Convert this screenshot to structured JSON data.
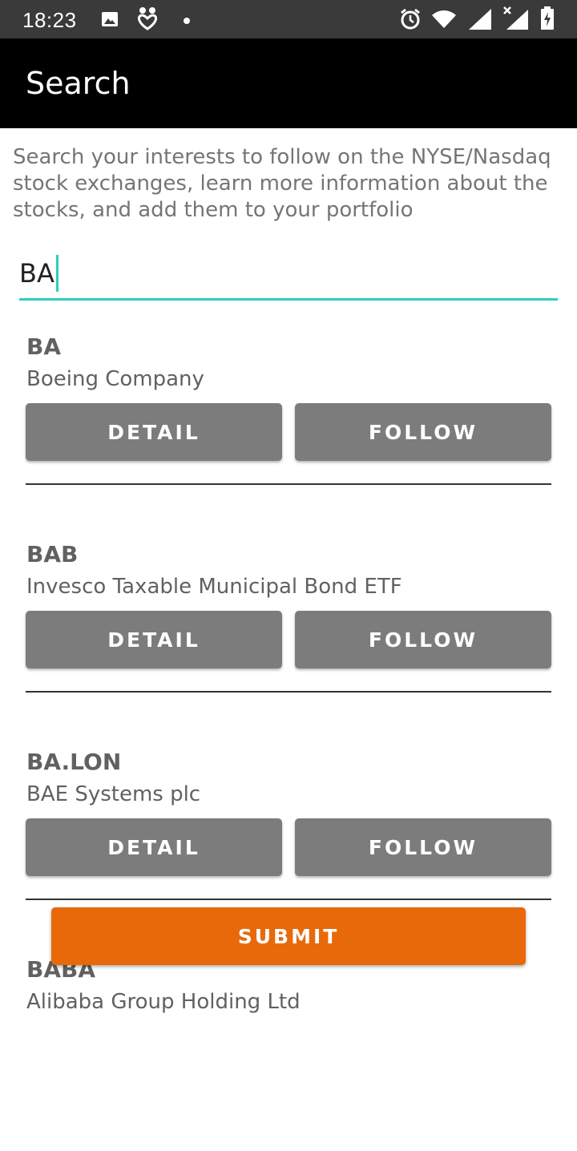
{
  "status_bar": {
    "time": "18:23",
    "icons": [
      "image-icon",
      "heart-app-icon",
      "dot-icon",
      "alarm-icon",
      "wifi-icon",
      "signal-icon",
      "signal-x-icon",
      "battery-icon"
    ]
  },
  "app_bar": {
    "title": "Search"
  },
  "description": "Search your interests to follow on the NYSE/Nasdaq stock exchanges, learn more information about the stocks, and add them to your portfolio",
  "search": {
    "value": "BA",
    "accent_color": "#2ecfbd"
  },
  "results": [
    {
      "symbol": "BA",
      "name": "Boeing Company",
      "detail_label": "DETAIL",
      "follow_label": "FOLLOW"
    },
    {
      "symbol": "BAB",
      "name": "Invesco Taxable Municipal Bond ETF",
      "detail_label": "DETAIL",
      "follow_label": "FOLLOW"
    },
    {
      "symbol": "BA.LON",
      "name": "BAE Systems plc",
      "detail_label": "DETAIL",
      "follow_label": "FOLLOW"
    },
    {
      "symbol": "BABA",
      "name": "Alibaba Group Holding Ltd"
    }
  ],
  "submit": {
    "label": "SUBMIT",
    "color": "#e8690a"
  },
  "colors": {
    "button_gray": "#7c7c7c",
    "appbar": "#000000",
    "statusbar": "#3a3a3a"
  }
}
